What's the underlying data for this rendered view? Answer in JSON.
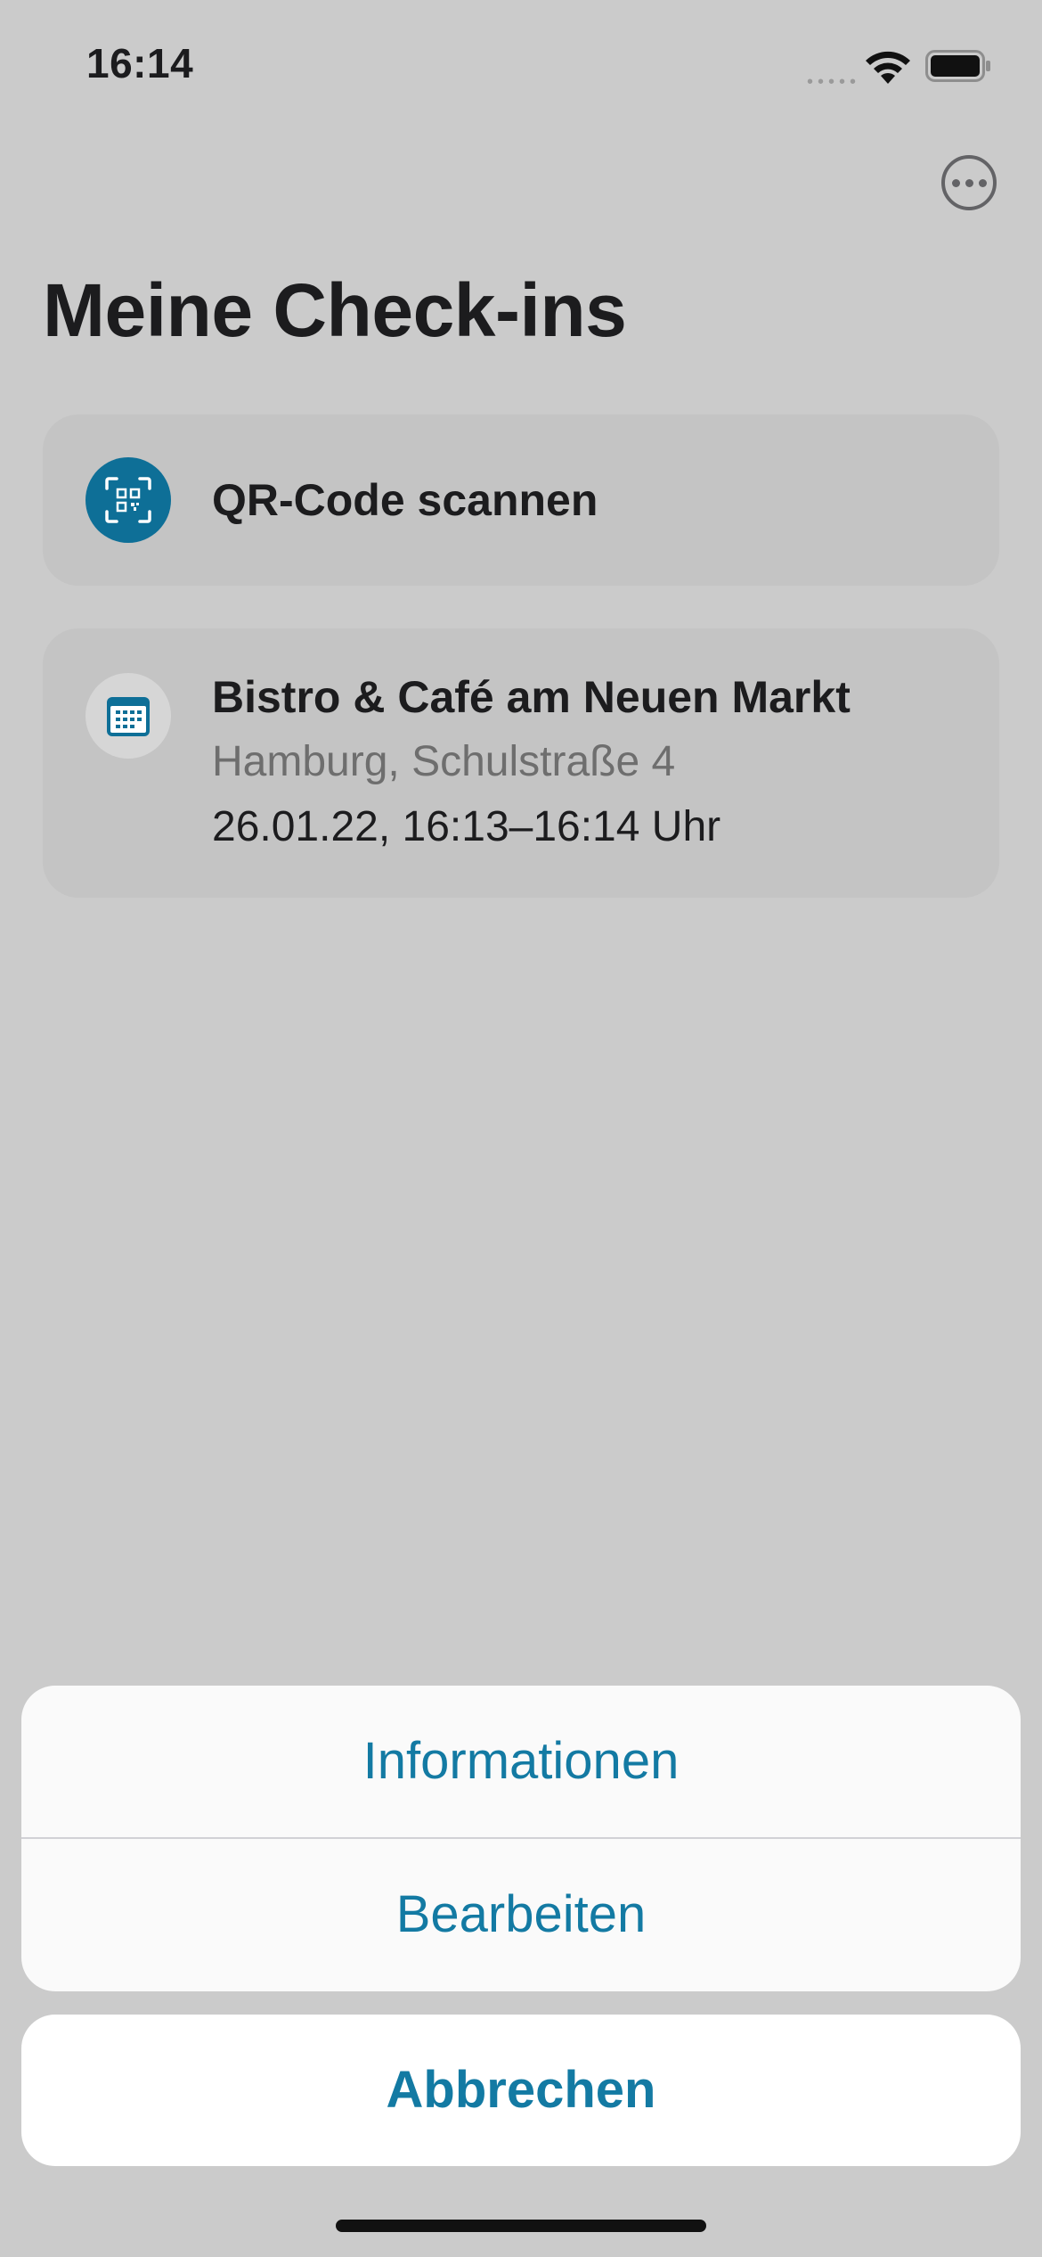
{
  "status_bar": {
    "time": "16:14",
    "signal_dots": "•••••"
  },
  "header": {
    "more_icon": "ellipsis-circle-icon",
    "title": "Meine Check-ins"
  },
  "scan_card": {
    "icon": "qr-scan-icon",
    "label": "QR-Code scannen"
  },
  "checkins": [
    {
      "icon": "calendar-icon",
      "name": "Bistro & Café am Neuen Markt",
      "address": "Hamburg, Schulstraße 4",
      "time": "26.01.22, 16:13–16:14 Uhr"
    }
  ],
  "action_sheet": {
    "items": [
      {
        "label": "Informationen"
      },
      {
        "label": "Bearbeiten"
      }
    ],
    "cancel_label": "Abbrechen"
  },
  "colors": {
    "accent": "#137aa3",
    "icon_bg": "#0e6f97",
    "dimmed_background": "#cbcbcb"
  }
}
